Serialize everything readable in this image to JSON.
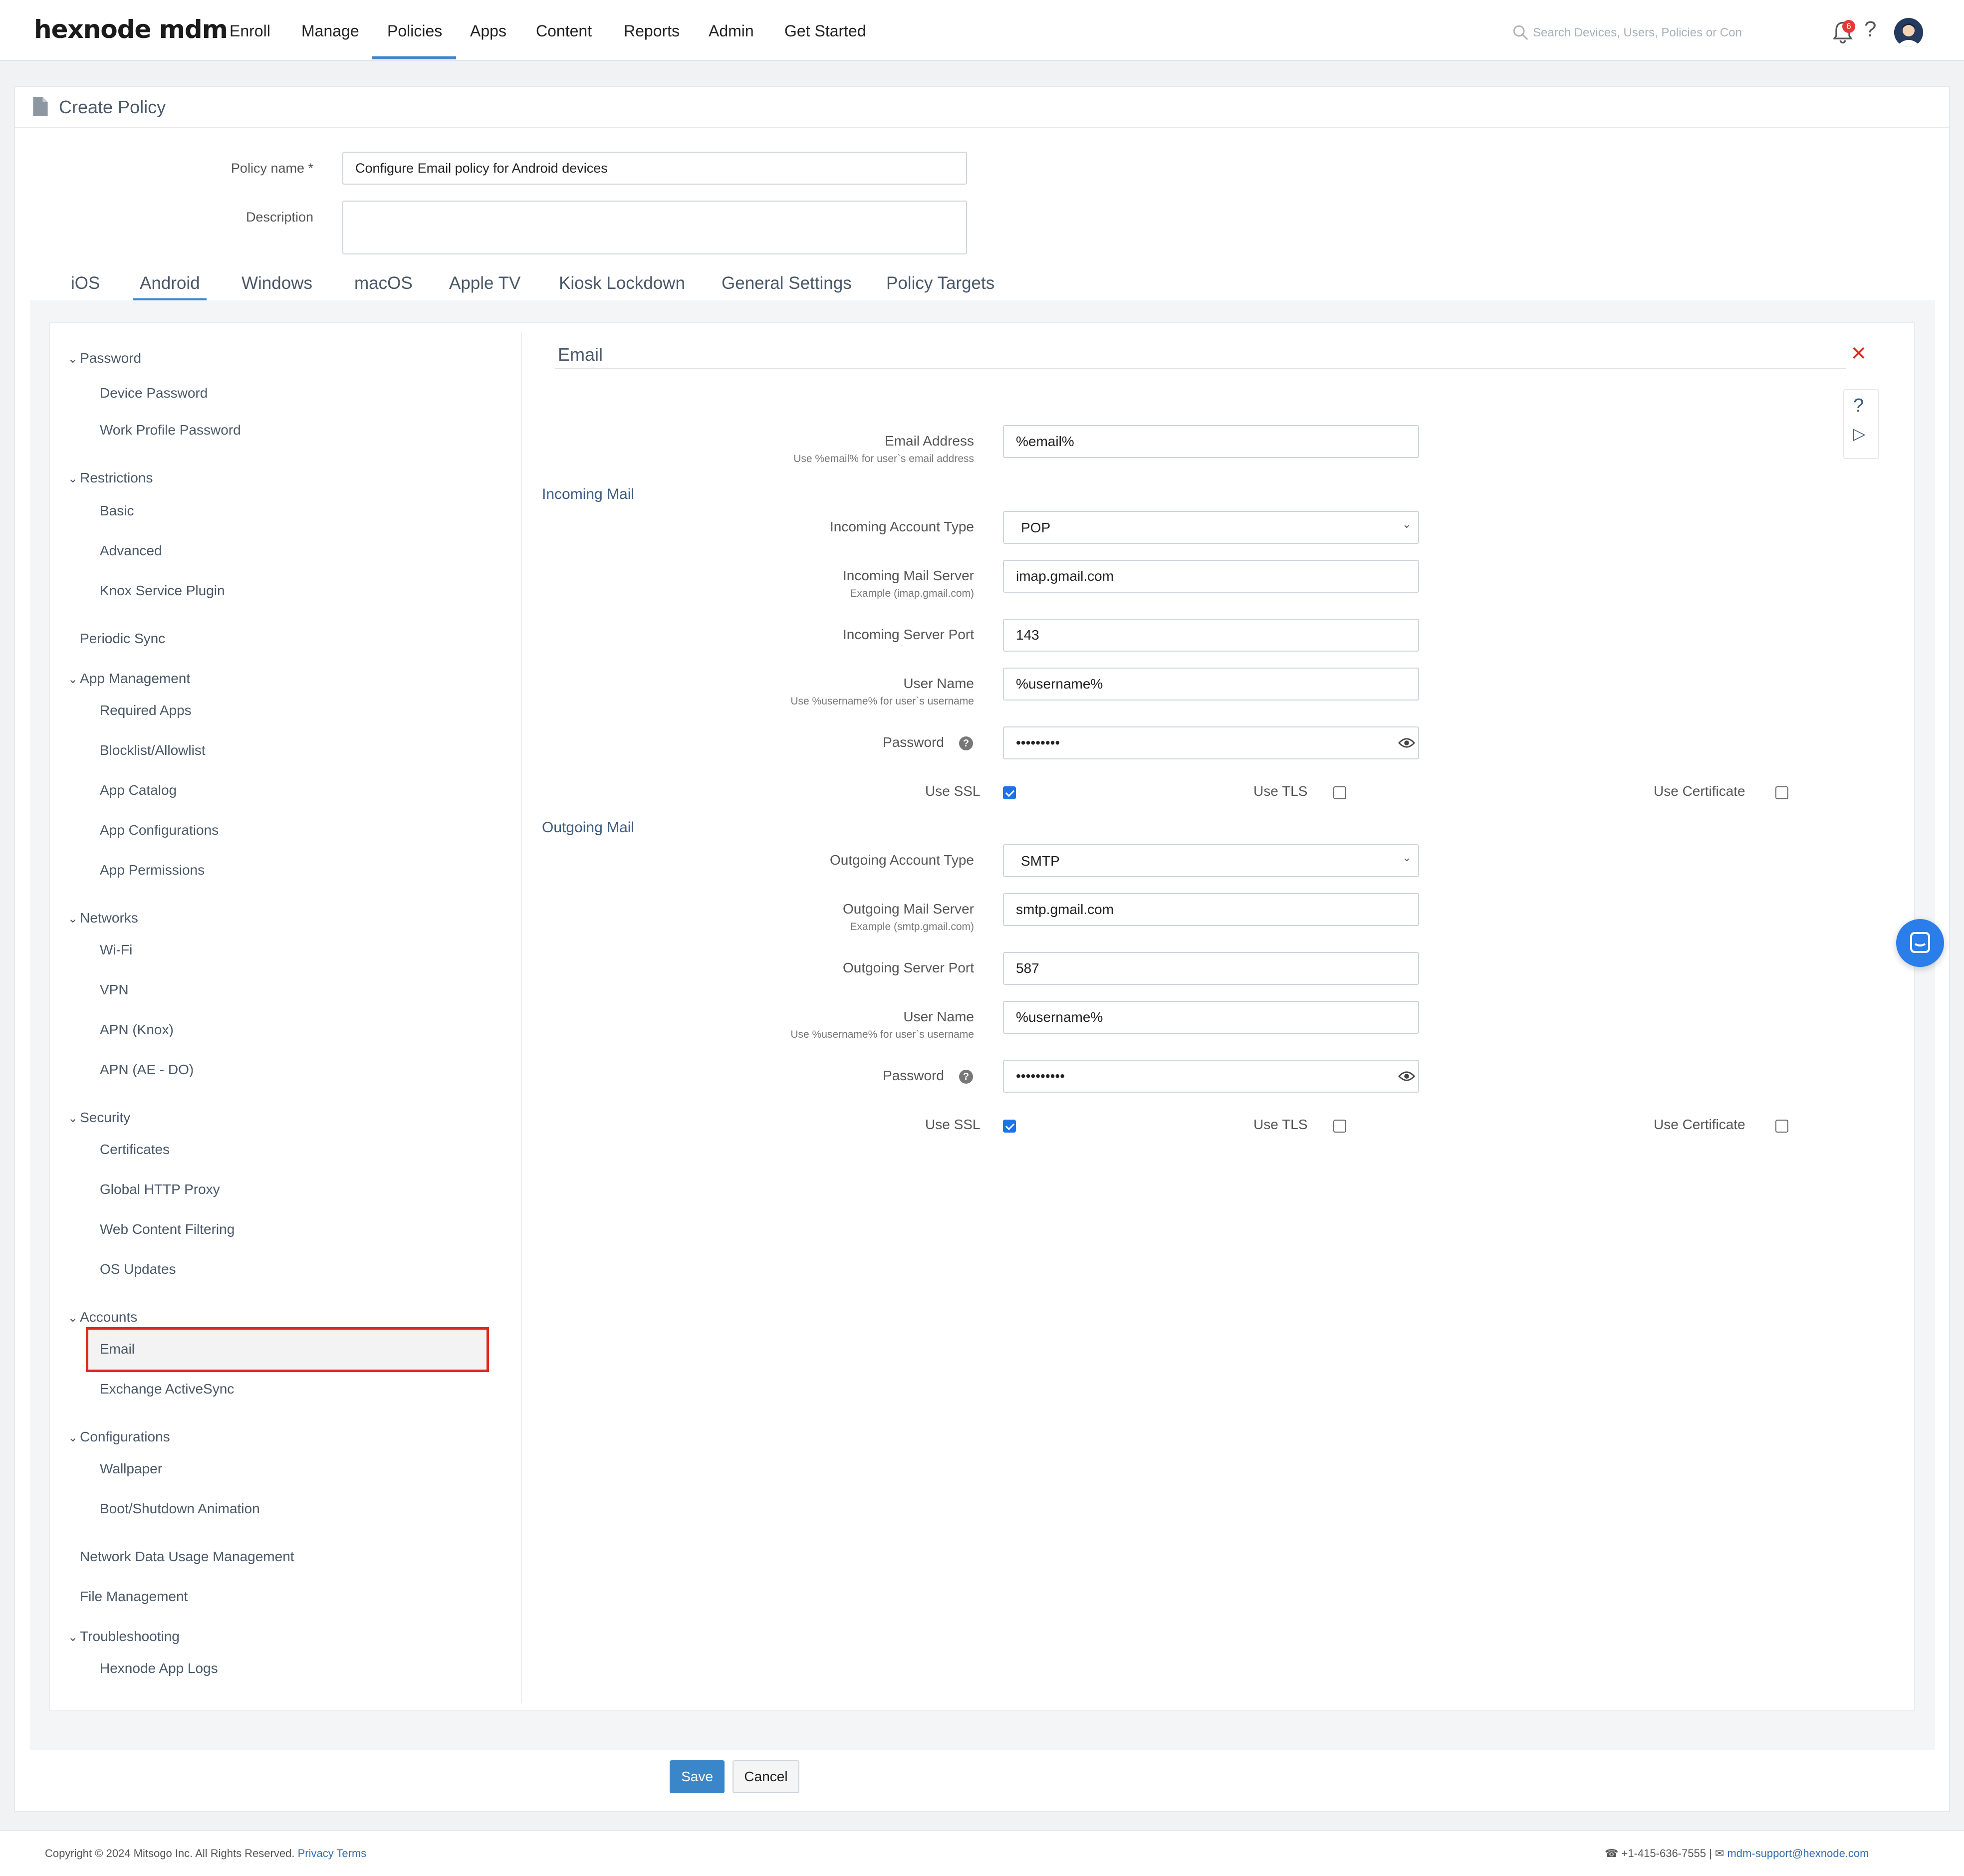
{
  "app": {
    "logo": "hexnode mdm",
    "nav": [
      "Enroll",
      "Manage",
      "Policies",
      "Apps",
      "Content",
      "Reports",
      "Admin",
      "Get Started"
    ],
    "active_nav": "Policies",
    "search_placeholder": "Search Devices, Users, Policies or Content",
    "notification_count": "6",
    "help_label": "?"
  },
  "page": {
    "title": "Create Policy",
    "policy_name_label": "Policy name *",
    "policy_name_value": "Configure Email policy for Android devices",
    "description_label": "Description",
    "description_value": ""
  },
  "tabs": [
    "iOS",
    "Android",
    "Windows",
    "macOS",
    "Apple TV",
    "Kiosk Lockdown",
    "General Settings",
    "Policy Targets"
  ],
  "active_tab": "Android",
  "sidebar": {
    "password": "Password",
    "device_password": "Device Password",
    "work_profile_password": "Work Profile Password",
    "restrictions": "Restrictions",
    "basic": "Basic",
    "advanced": "Advanced",
    "knox_service_plugin": "Knox Service Plugin",
    "periodic_sync": "Periodic Sync",
    "app_management": "App Management",
    "required_apps": "Required Apps",
    "blocklist_allowlist": "Blocklist/Allowlist",
    "app_catalog": "App Catalog",
    "app_configurations": "App Configurations",
    "app_permissions": "App Permissions",
    "networks": "Networks",
    "wifi": "Wi-Fi",
    "vpn": "VPN",
    "apn_knox": "APN (Knox)",
    "apn_ae_do": "APN (AE - DO)",
    "security": "Security",
    "certificates": "Certificates",
    "global_http_proxy": "Global HTTP Proxy",
    "web_content_filtering": "Web Content Filtering",
    "os_updates": "OS Updates",
    "accounts": "Accounts",
    "email": "Email",
    "exchange_activesync": "Exchange ActiveSync",
    "configurations": "Configurations",
    "wallpaper": "Wallpaper",
    "boot_shutdown_animation": "Boot/Shutdown Animation",
    "network_data_usage": "Network Data Usage Management",
    "file_management": "File Management",
    "troubleshooting": "Troubleshooting",
    "hexnode_app_logs": "Hexnode App Logs"
  },
  "email_panel": {
    "title": "Email",
    "close": "✕",
    "email_address_label": "Email Address",
    "email_address_hint": "Use %email% for user`s email address",
    "email_address_value": "%email%",
    "incoming_heading": "Incoming Mail",
    "incoming_account_type_label": "Incoming Account Type",
    "incoming_account_type_value": "POP",
    "incoming_mail_server_label": "Incoming Mail Server",
    "incoming_mail_server_hint": "Example (imap.gmail.com)",
    "incoming_mail_server_value": "imap.gmail.com",
    "incoming_server_port_label": "Incoming Server Port",
    "incoming_server_port_value": "143",
    "incoming_username_label": "User Name",
    "incoming_username_hint": "Use %username% for user`s username",
    "incoming_username_value": "%username%",
    "incoming_password_label": "Password",
    "incoming_password_value": "•••••••••",
    "incoming_use_ssl_label": "Use SSL",
    "incoming_use_ssl": true,
    "incoming_use_tls_label": "Use TLS",
    "incoming_use_tls": false,
    "incoming_use_certificate_label": "Use Certificate",
    "incoming_use_certificate": false,
    "outgoing_heading": "Outgoing Mail",
    "outgoing_account_type_label": "Outgoing Account Type",
    "outgoing_account_type_value": "SMTP",
    "outgoing_mail_server_label": "Outgoing Mail Server",
    "outgoing_mail_server_hint": "Example (smtp.gmail.com)",
    "outgoing_mail_server_value": "smtp.gmail.com",
    "outgoing_server_port_label": "Outgoing Server Port",
    "outgoing_server_port_value": "587",
    "outgoing_username_label": "User Name",
    "outgoing_username_hint": "Use %username% for user`s username",
    "outgoing_username_value": "%username%",
    "outgoing_password_label": "Password",
    "outgoing_password_value": "••••••••••",
    "outgoing_use_ssl_label": "Use SSL",
    "outgoing_use_ssl": true,
    "outgoing_use_tls_label": "Use TLS",
    "outgoing_use_tls": false,
    "outgoing_use_certificate_label": "Use Certificate",
    "outgoing_use_certificate": false
  },
  "actions": {
    "save": "Save",
    "cancel": "Cancel"
  },
  "footer": {
    "copyright": "Copyright © 2024 Mitsogo Inc. All Rights Reserved.",
    "privacy": "Privacy",
    "terms": "Terms",
    "phone": "+1-415-636-7555",
    "separator": "|",
    "email": "mdm-support@hexnode.com"
  },
  "colors": {
    "accent": "#3a86c8",
    "highlight_border": "#e0281a",
    "checkbox_checked": "#1a73e8"
  }
}
